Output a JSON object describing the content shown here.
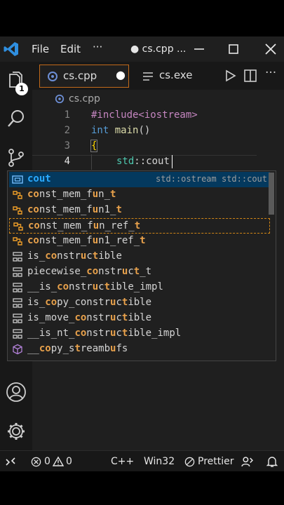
{
  "menu": {
    "file": "File",
    "edit": "Edit",
    "more": "···"
  },
  "window_title": "● cs.cpp ...",
  "tabs": [
    {
      "label": "cs.cpp",
      "modified": "●"
    },
    {
      "label": "cs.exe"
    }
  ],
  "breadcrumb": "cs.cpp",
  "account_badge": "1",
  "code_lines": [
    {
      "num": "1",
      "text": "#include<iostream>"
    },
    {
      "num": "2",
      "kw": "int",
      "fn": "main",
      "rest": "()"
    },
    {
      "num": "3",
      "text": "{"
    },
    {
      "num": "4",
      "ns": "std",
      "sep": "::",
      "id": "cout"
    }
  ],
  "suggestions": [
    {
      "pre": "",
      "m1": "cout",
      "post": "",
      "detail": "std::ostream std::cout",
      "icon": "variable-icon"
    },
    {
      "pre": "",
      "m1": "co",
      "mid": "nst_mem_f",
      "m2": "u",
      "post": "n_",
      "m3": "t",
      "post2": "",
      "icon": "class-icon"
    },
    {
      "pre": "",
      "m1": "co",
      "mid": "nst_mem_f",
      "m2": "u",
      "post": "n1_",
      "m3": "t",
      "post2": "",
      "icon": "class-icon"
    },
    {
      "pre": "",
      "m1": "co",
      "mid": "nst_mem_f",
      "m2": "u",
      "post": "n_ref_",
      "m3": "t",
      "post2": "",
      "icon": "class-icon"
    },
    {
      "pre": "",
      "m1": "co",
      "mid": "nst_mem_f",
      "m2": "u",
      "post": "n1_ref_",
      "m3": "t",
      "post2": "",
      "icon": "class-icon"
    },
    {
      "pre": "is_",
      "m1": "co",
      "mid": "nstr",
      "m2": "u",
      "post": "c",
      "m3": "t",
      "post2": "ible",
      "icon": "struct-icon"
    },
    {
      "pre": "piecewise_",
      "m1": "co",
      "mid": "nstr",
      "m2": "u",
      "post": "c",
      "m3": "t",
      "post2": "_t",
      "icon": "struct-icon"
    },
    {
      "pre": "__is_",
      "m1": "co",
      "mid": "nstr",
      "m2": "u",
      "post": "c",
      "m3": "t",
      "post2": "ible_impl",
      "icon": "struct-icon"
    },
    {
      "pre": "is_",
      "m1": "co",
      "mid": "py_constr",
      "m2": "u",
      "post": "c",
      "m3": "t",
      "post2": "ible",
      "icon": "struct-icon"
    },
    {
      "pre": "is_move_",
      "m1": "co",
      "mid": "nstr",
      "m2": "u",
      "post": "c",
      "m3": "t",
      "post2": "ible",
      "icon": "struct-icon"
    },
    {
      "pre": "__is_nt_",
      "m1": "co",
      "mid": "nstr",
      "m2": "u",
      "post": "c",
      "m3": "t",
      "post2": "ible_impl",
      "icon": "struct-icon"
    },
    {
      "pre": "__",
      "m1": "co",
      "mid": "py_s",
      "m2": "t",
      "post": "reamb",
      "m3": "u",
      "post2": "fs",
      "icon": "cube-icon"
    }
  ],
  "status": {
    "errors": "0",
    "warnings": "0",
    "language": "C++",
    "config": "Win32",
    "formatter": "Prettier"
  },
  "colors": {
    "accent": "#c26a1b",
    "selection": "#04395e",
    "match": "#e8a14b"
  }
}
